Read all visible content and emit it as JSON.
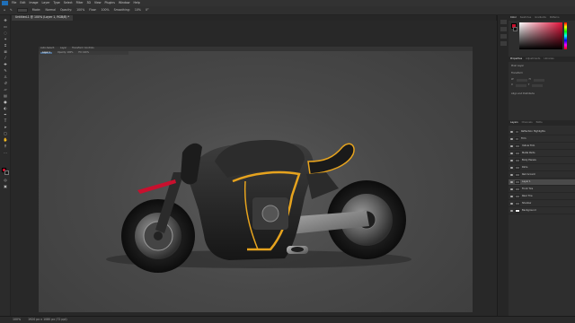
{
  "menubar": {
    "items": [
      "File",
      "Edit",
      "Image",
      "Layer",
      "Type",
      "Select",
      "Filter",
      "3D",
      "View",
      "Plugins",
      "Window",
      "Help"
    ]
  },
  "options": {
    "mode_label": "Mode:",
    "mode_value": "Normal",
    "opacity_label": "Opacity:",
    "opacity_value": "100%",
    "flow_label": "Flow:",
    "flow_value": "100%",
    "smoothing_label": "Smoothing:",
    "smoothing_value": "10%",
    "angle_value": "0°"
  },
  "document": {
    "tab_label": "Untitled-1 @ 100% (Layer 1, RGB/8) *",
    "zoom": "100%"
  },
  "canvas": {
    "inner_items": [
      "Auto-Select:",
      "Layer",
      "Transform Controls"
    ],
    "inner_items2": [
      "Layer 1",
      "Opacity: 100%",
      "Fill: 100%"
    ]
  },
  "statusbar": {
    "zoom": "100%",
    "doc_info": "1920 px x 1080 px (72 ppi)"
  },
  "panels": {
    "color_tabs": [
      "Color",
      "Swatches",
      "Gradients",
      "Patterns"
    ],
    "props_tabs": [
      "Properties",
      "Adjustments",
      "Libraries"
    ],
    "props_title": "Pixel Layer",
    "transform_label": "Transform",
    "w_label": "W",
    "h_label": "H",
    "x_label": "X",
    "y_label": "Y",
    "align_label": "Align and Distribute",
    "layers_tabs": [
      "Layers",
      "Channels",
      "Paths"
    ],
    "layers": [
      {
        "name": "Reflection Highlights",
        "kind": "grp"
      },
      {
        "name": "Trim",
        "kind": "grp"
      },
      {
        "name": "Yellow Trim",
        "kind": "normal"
      },
      {
        "name": "Metal Parts",
        "kind": "normal"
      },
      {
        "name": "Body Panels",
        "kind": "normal"
      },
      {
        "name": "Rims",
        "kind": "normal"
      },
      {
        "name": "Red Accent",
        "kind": "normal"
      },
      {
        "name": "Layer 1",
        "kind": "sel"
      },
      {
        "name": "Front Tire",
        "kind": "normal"
      },
      {
        "name": "Rear Tire",
        "kind": "normal"
      },
      {
        "name": "Shadow",
        "kind": "normal"
      },
      {
        "name": "Background",
        "kind": "white"
      }
    ]
  },
  "colors": {
    "foreground": "#c8102e",
    "accent_yellow": "#e6a31e",
    "canvas_bg": "#4b4b4b"
  }
}
